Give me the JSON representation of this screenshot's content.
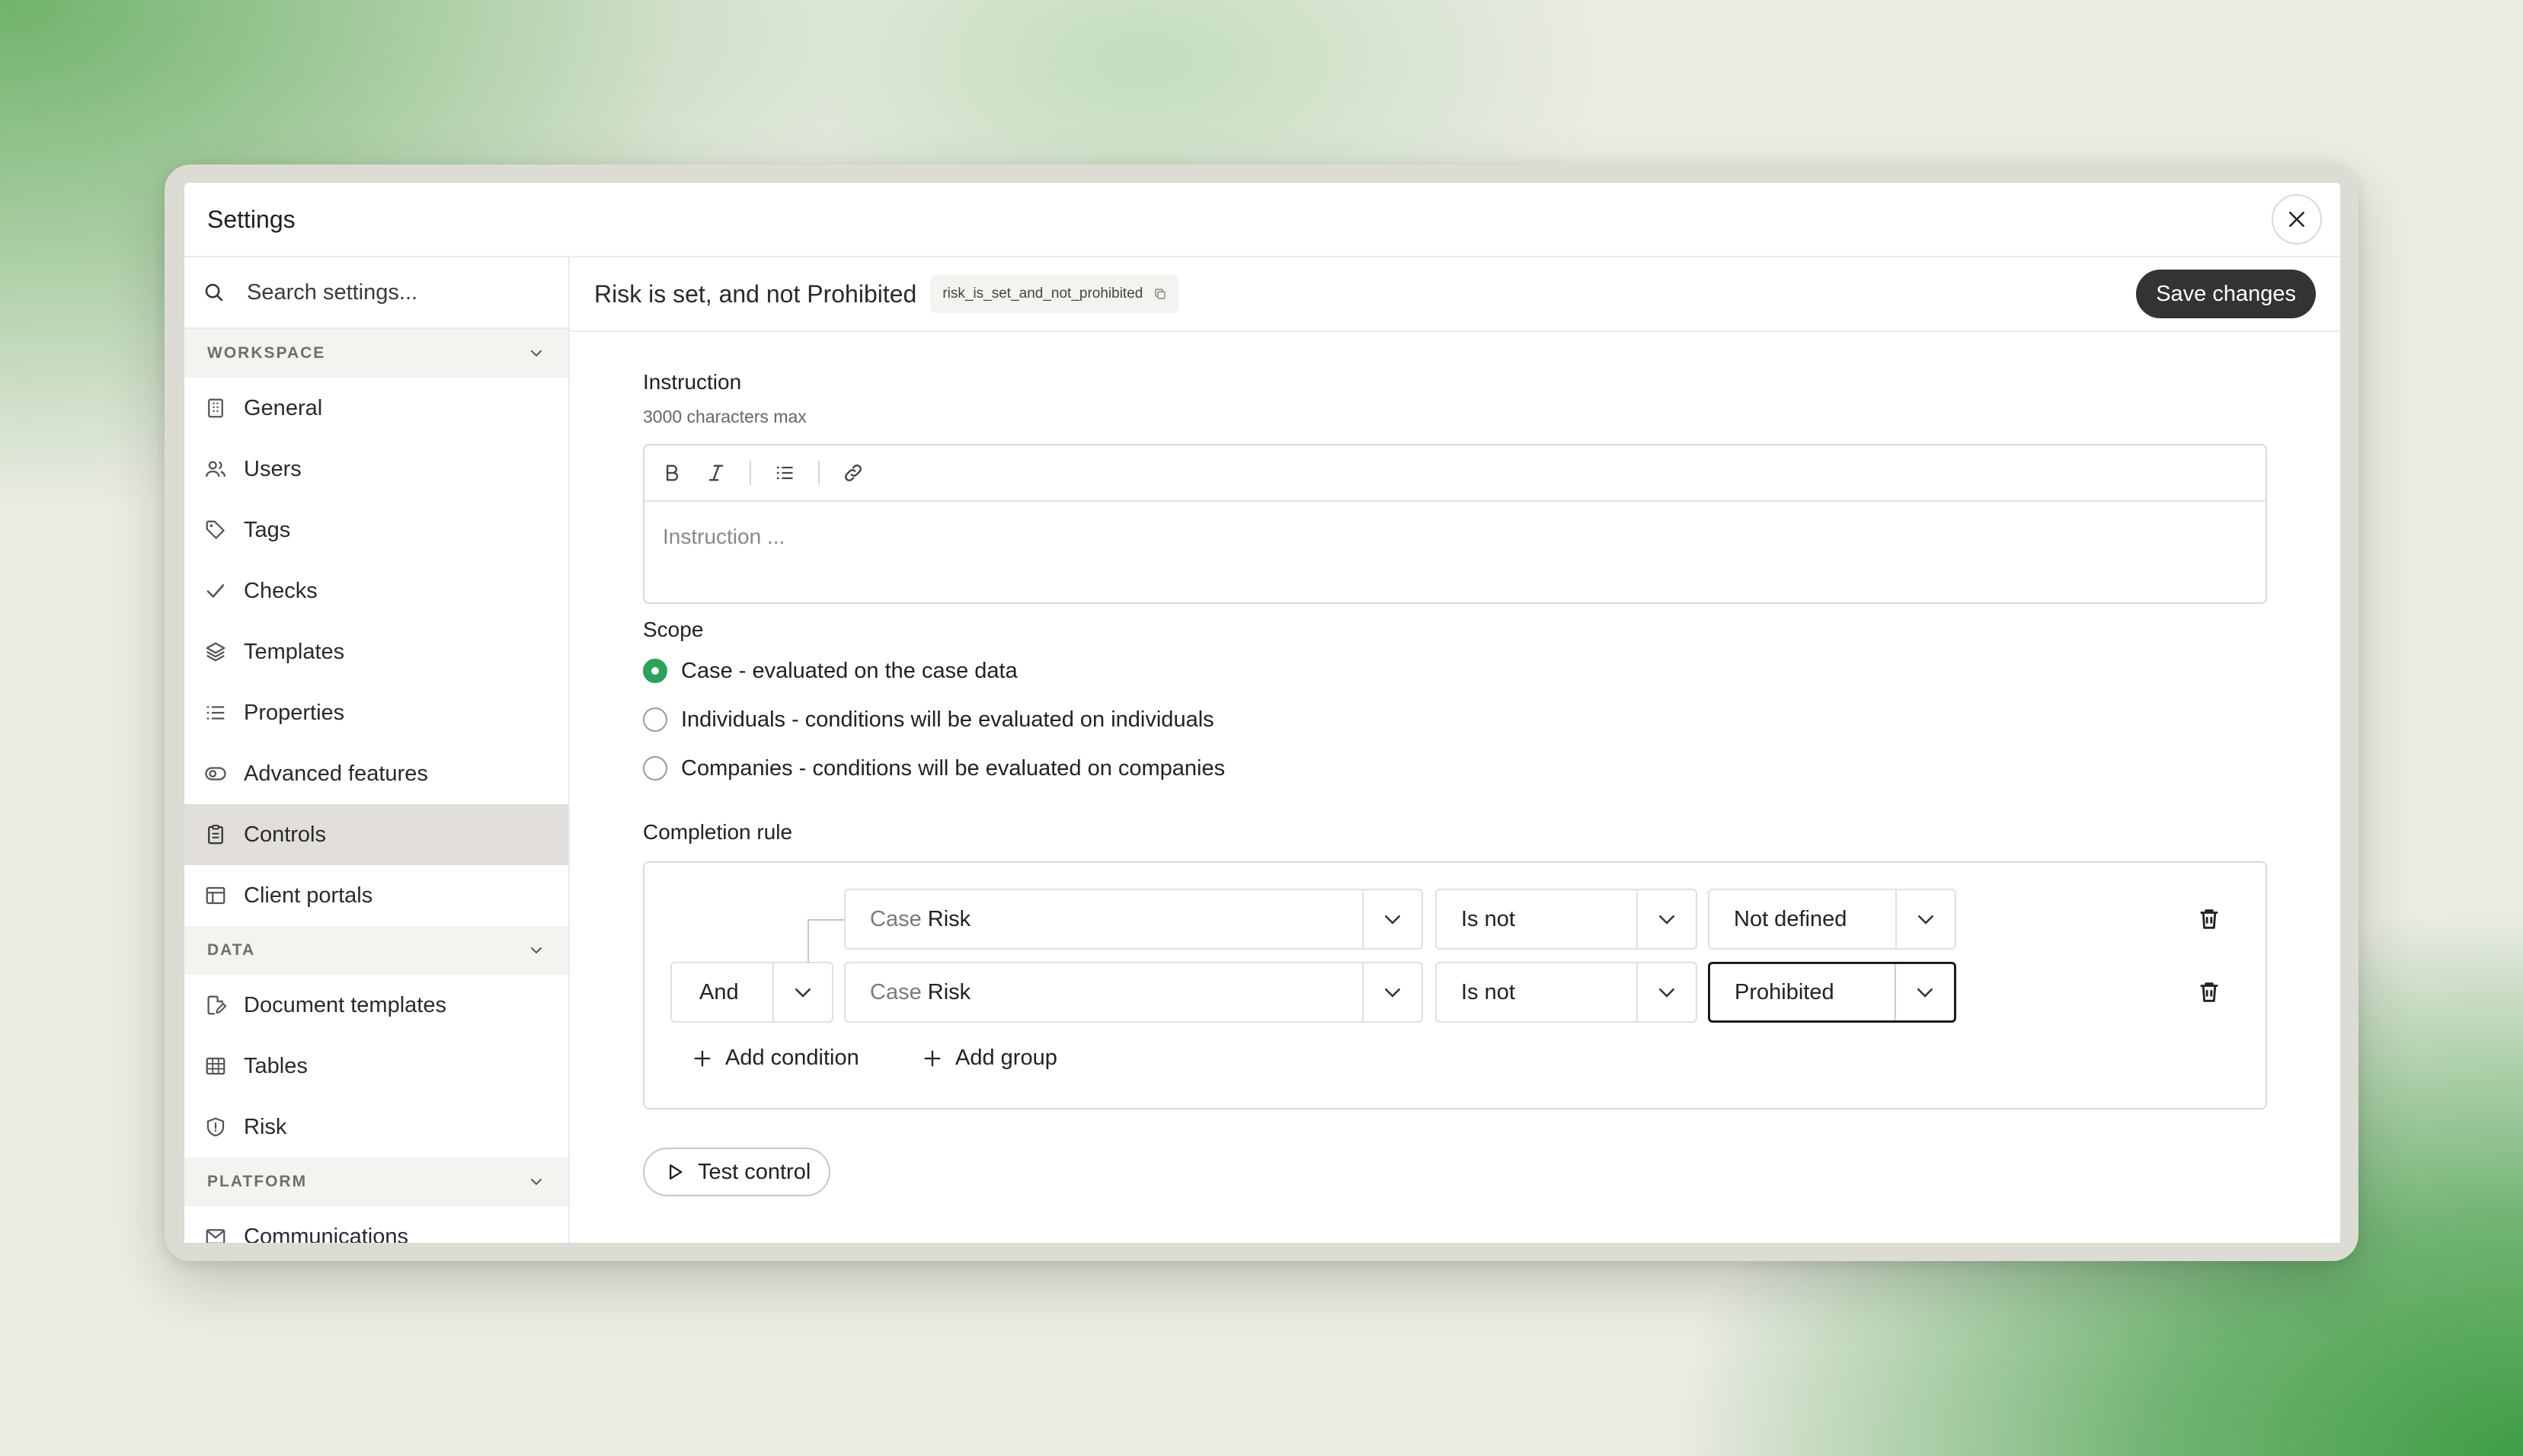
{
  "window": {
    "title": "Settings"
  },
  "search": {
    "placeholder": "Search settings..."
  },
  "sidebar": {
    "sections": [
      {
        "title": "WORKSPACE",
        "items": [
          "General",
          "Users",
          "Tags",
          "Checks",
          "Templates",
          "Properties",
          "Advanced features",
          "Controls",
          "Client portals"
        ]
      },
      {
        "title": "DATA",
        "items": [
          "Document templates",
          "Tables",
          "Risk"
        ]
      },
      {
        "title": "PLATFORM",
        "items": [
          "Communications"
        ]
      }
    ],
    "active_item": "Controls"
  },
  "header": {
    "title": "Risk is set, and not Prohibited",
    "slug": "risk_is_set_and_not_prohibited",
    "save_label": "Save changes"
  },
  "instruction": {
    "label": "Instruction",
    "hint": "3000 characters max",
    "placeholder": "Instruction ..."
  },
  "scope": {
    "label": "Scope",
    "options": [
      {
        "label": "Case - evaluated on the case data",
        "selected": true
      },
      {
        "label": "Individuals - conditions will be evaluated on individuals",
        "selected": false
      },
      {
        "label": "Companies - conditions will be evaluated on companies",
        "selected": false
      }
    ]
  },
  "completion_rule": {
    "label": "Completion rule",
    "operator": "And",
    "conditions": [
      {
        "field_prefix": "Case",
        "field": "Risk",
        "comparator": "Is not",
        "value": "Not defined"
      },
      {
        "field_prefix": "Case",
        "field": "Risk",
        "comparator": "Is not",
        "value": "Prohibited"
      }
    ],
    "add_condition_label": "Add condition",
    "add_group_label": "Add group"
  },
  "test_label": "Test control",
  "colors": {
    "accent_green": "#2aa35a",
    "save_button": "#333331",
    "active_nav": "#e1dedb"
  }
}
